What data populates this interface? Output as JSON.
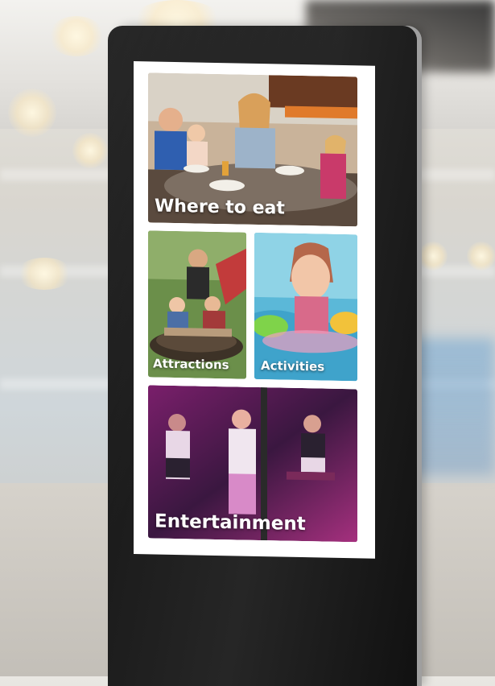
{
  "kiosk_menu": {
    "tiles": [
      {
        "label": "Where to eat"
      },
      {
        "label": "Attractions"
      },
      {
        "label": "Activities"
      },
      {
        "label": "Entertainment"
      }
    ]
  }
}
